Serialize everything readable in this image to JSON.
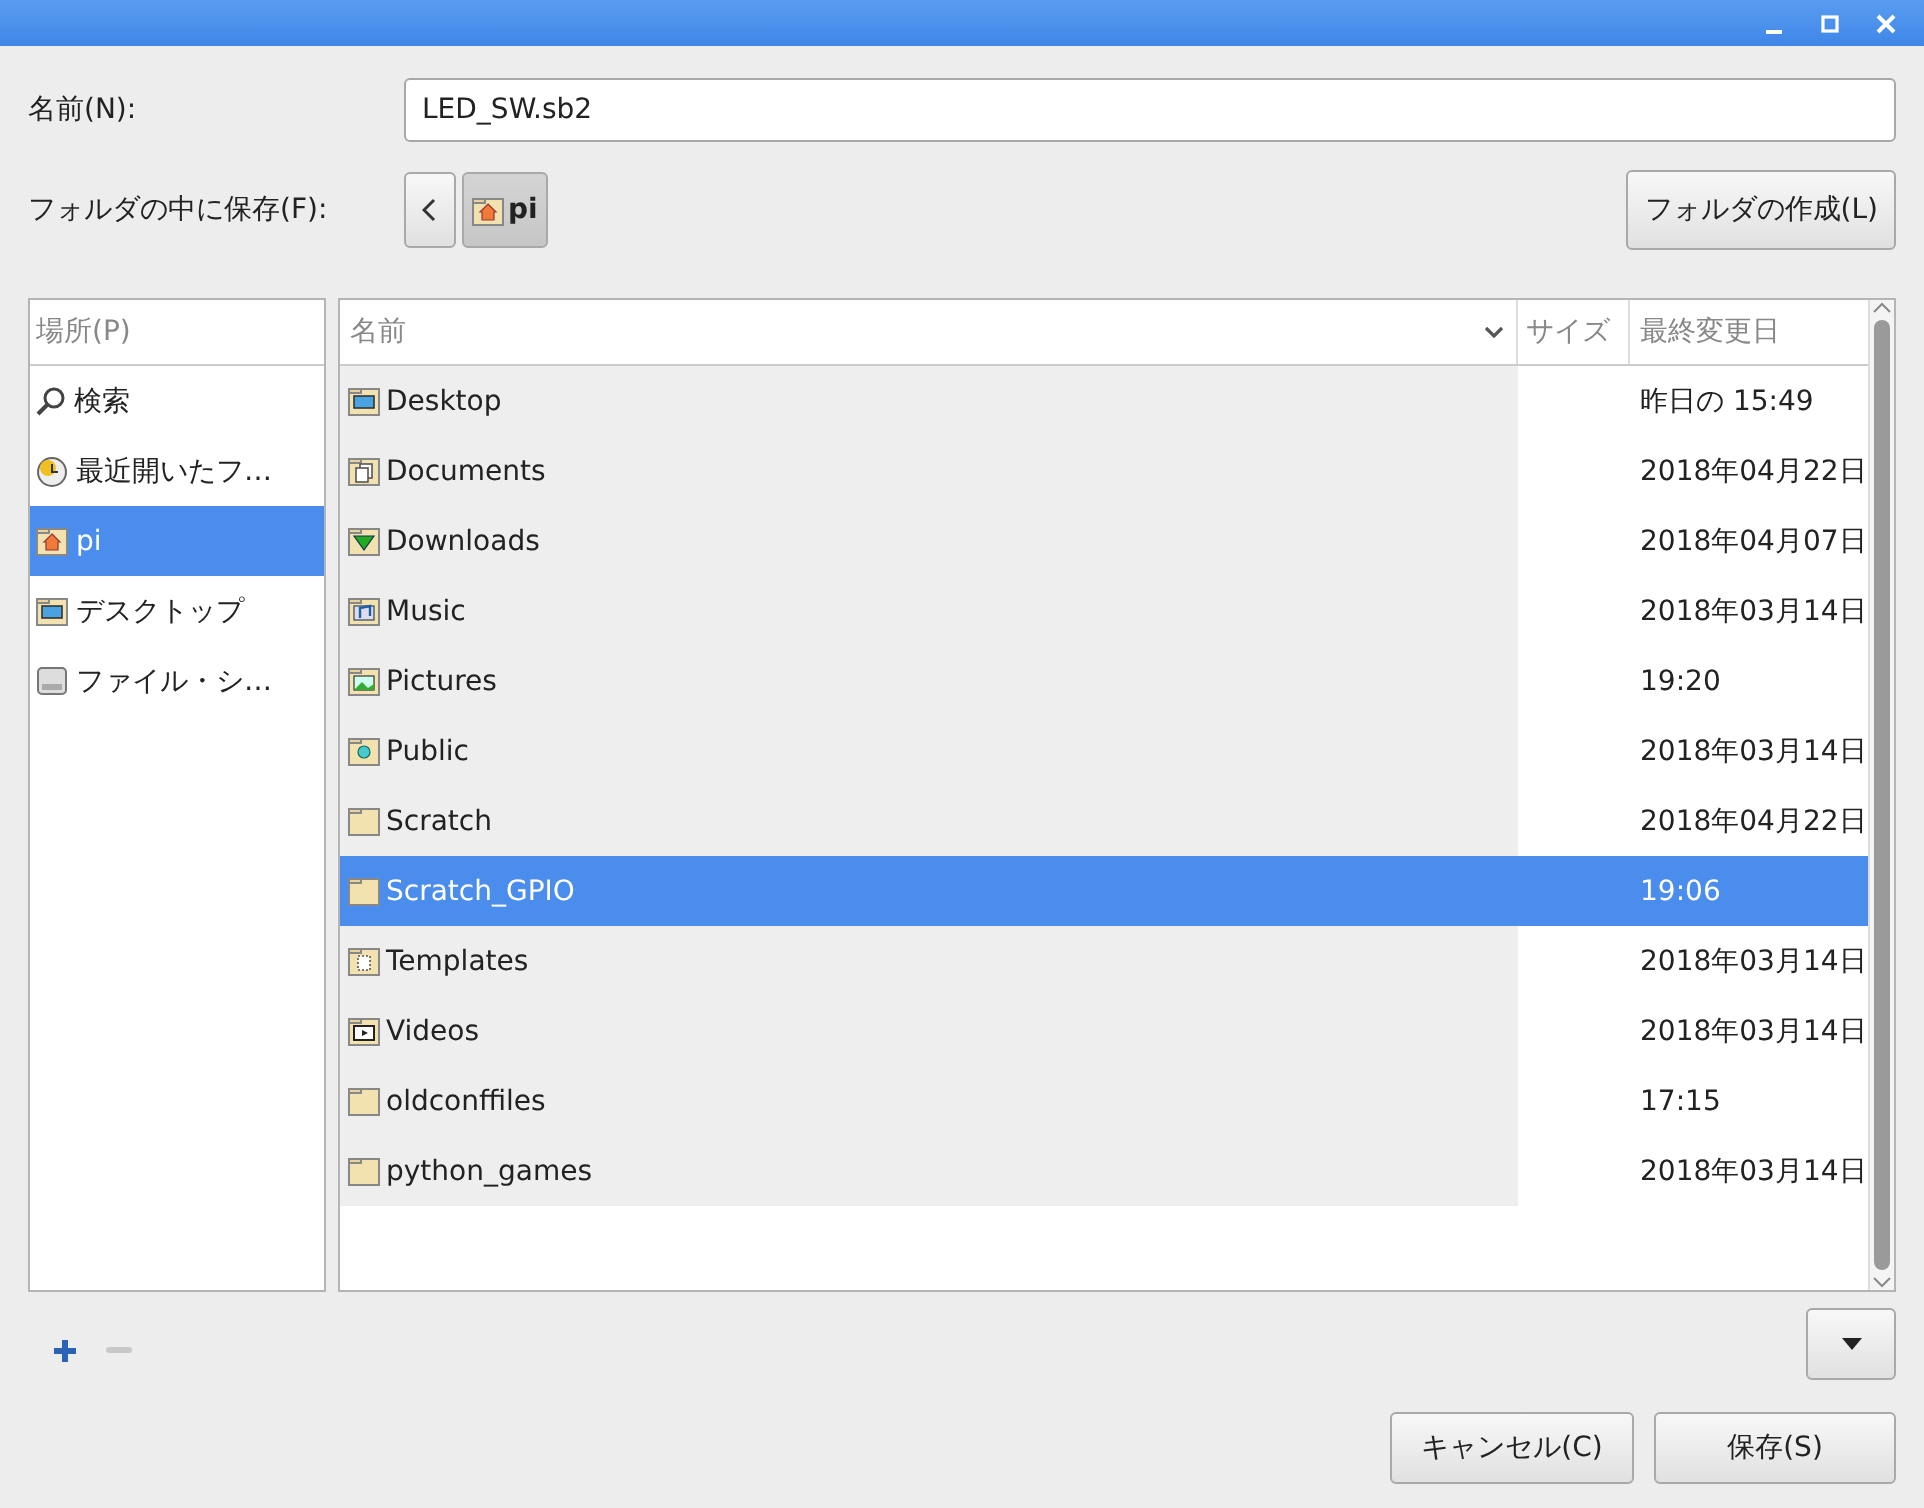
{
  "name_field": {
    "label": "名前(N):",
    "value": "LED_SW.sb2"
  },
  "save_in": {
    "label": "フォルダの中に保存(F):",
    "path": [
      {
        "label": "pi",
        "kind": "home"
      }
    ],
    "create_folder": "フォルダの作成(L)"
  },
  "places": {
    "header": "場所(P)",
    "items": [
      {
        "label": "検索",
        "kind": "search",
        "selected": false
      },
      {
        "label": "最近開いたフ…",
        "kind": "recent",
        "selected": false
      },
      {
        "label": "pi",
        "kind": "home",
        "selected": true
      },
      {
        "label": "デスクトップ",
        "kind": "desktop",
        "selected": false
      },
      {
        "label": "ファイル・シ…",
        "kind": "drive",
        "selected": false
      }
    ]
  },
  "table": {
    "columns": [
      "名前",
      "サイズ",
      "最終変更日"
    ],
    "rows": [
      {
        "name": "Desktop",
        "kind": "desktop",
        "modified": "昨日の 15:49",
        "selected": false
      },
      {
        "name": "Documents",
        "kind": "documents",
        "modified": "2018年04月22日",
        "selected": false
      },
      {
        "name": "Downloads",
        "kind": "downloads",
        "modified": "2018年04月07日",
        "selected": false
      },
      {
        "name": "Music",
        "kind": "music",
        "modified": "2018年03月14日",
        "selected": false
      },
      {
        "name": "Pictures",
        "kind": "pictures",
        "modified": "19:20",
        "selected": false
      },
      {
        "name": "Public",
        "kind": "public",
        "modified": "2018年03月14日",
        "selected": false
      },
      {
        "name": "Scratch",
        "kind": "plain",
        "modified": "2018年04月22日",
        "selected": false
      },
      {
        "name": "Scratch_GPIO",
        "kind": "plain",
        "modified": "19:06",
        "selected": true
      },
      {
        "name": "Templates",
        "kind": "templates",
        "modified": "2018年03月14日",
        "selected": false
      },
      {
        "name": "Videos",
        "kind": "videos",
        "modified": "2018年03月14日",
        "selected": false
      },
      {
        "name": "oldconffiles",
        "kind": "plain",
        "modified": "17:15",
        "selected": false
      },
      {
        "name": "python_games",
        "kind": "plain",
        "modified": "2018年03月14日",
        "selected": false
      }
    ]
  },
  "buttons": {
    "cancel": "キャンセル(C)",
    "save": "保存(S)"
  }
}
